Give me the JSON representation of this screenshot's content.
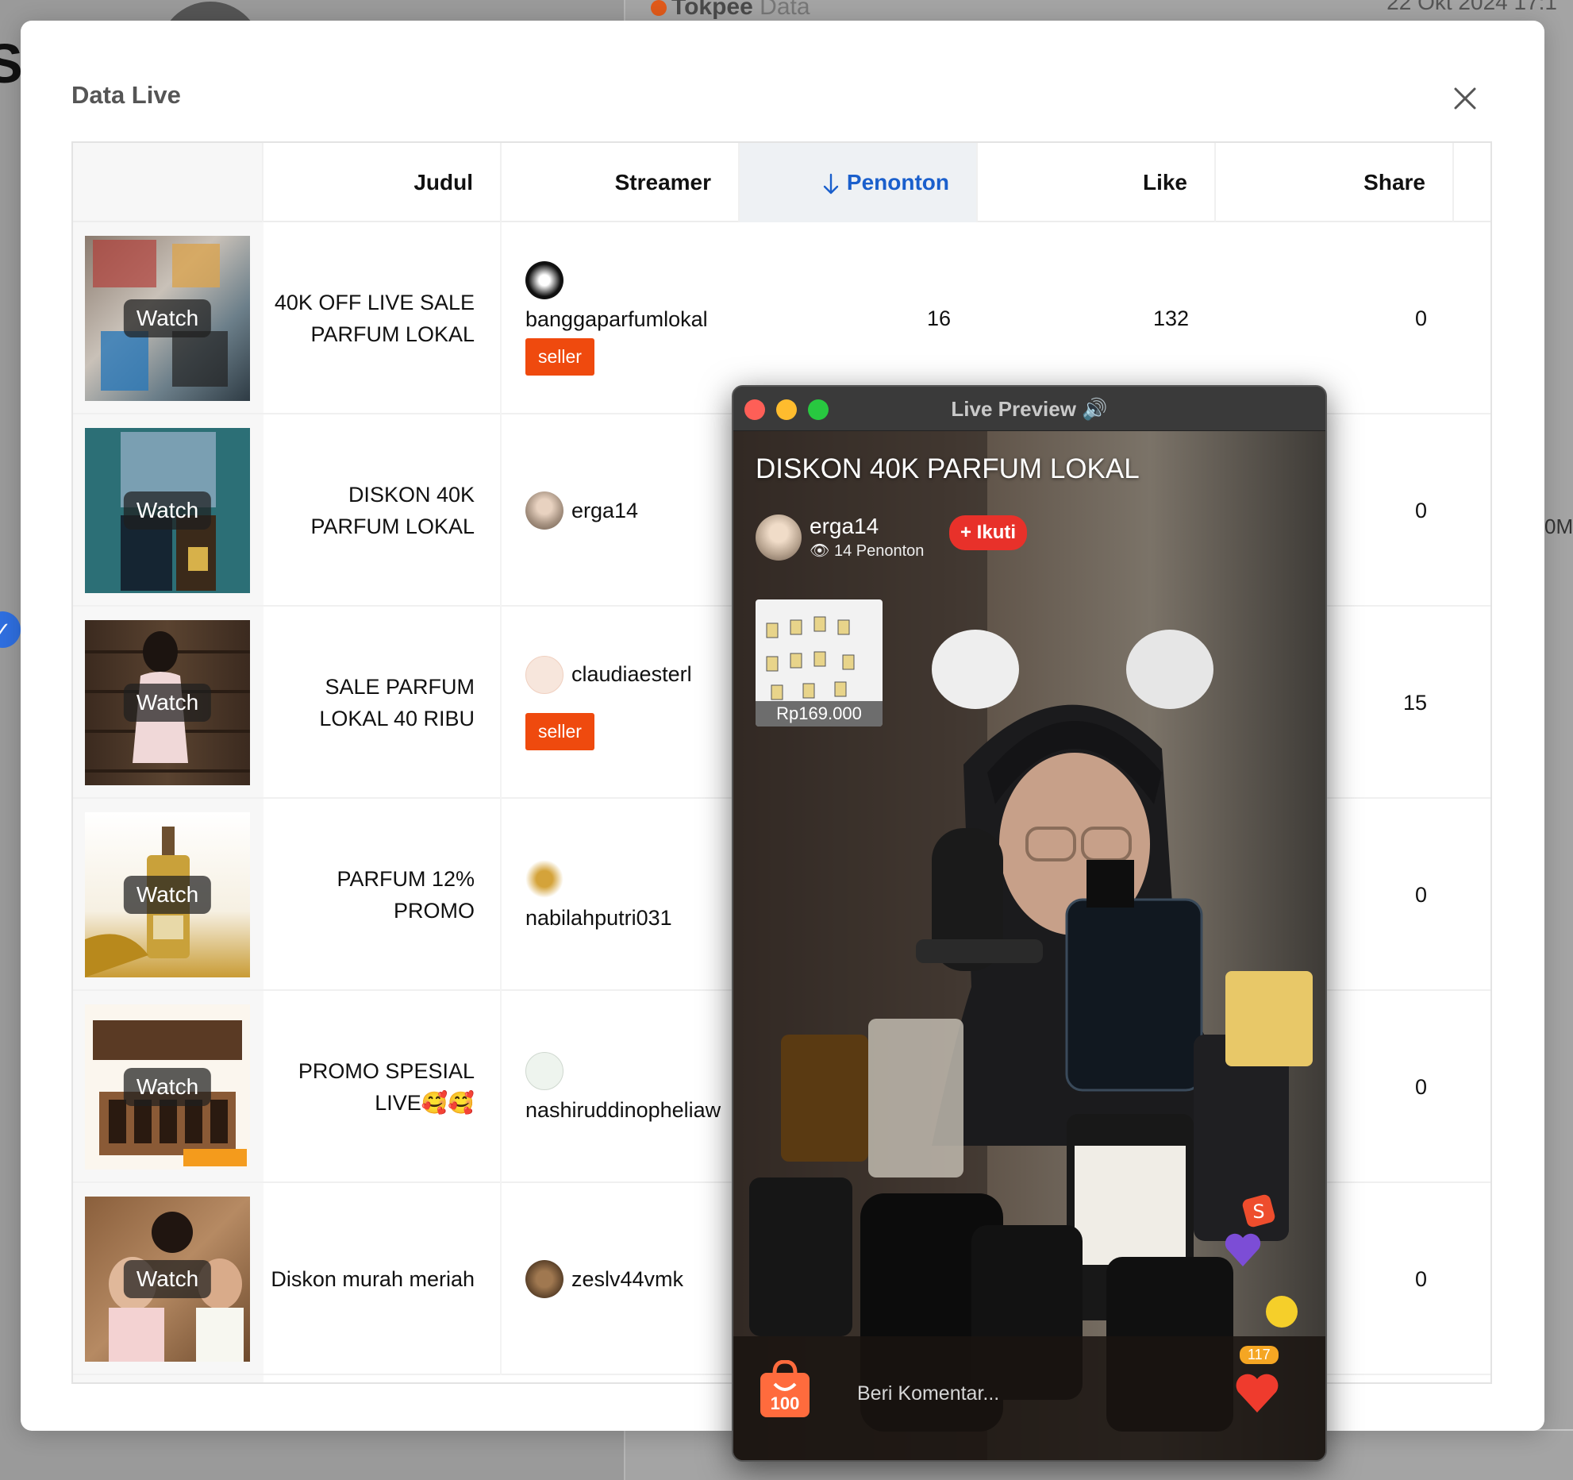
{
  "background": {
    "brand": "Tokpee",
    "brand_suffix": "Data",
    "date": "22 Okt 2024 17:1",
    "partial_letter": "S",
    "partial_value": "0M"
  },
  "modal": {
    "title": "Data Live",
    "close_icon": "close-icon"
  },
  "table": {
    "columns": [
      "Judul",
      "Streamer",
      "Penonton",
      "Like",
      "Share"
    ],
    "sorted_column": "Penonton",
    "sort_direction": "descending",
    "watch_label": "Watch",
    "seller_label": "seller",
    "rows": [
      {
        "title": "40K OFF LIVE SALE PARFUM LOKAL",
        "streamer": "banggaparfumlokal",
        "seller": true,
        "penonton": "16",
        "like": "132",
        "share": "0"
      },
      {
        "title": "DISKON 40K PARFUM LOKAL",
        "streamer": "erga14",
        "seller": false,
        "penonton": "",
        "like": "",
        "share": "0"
      },
      {
        "title": "SALE PARFUM LOKAL 40 RIBU",
        "streamer": "claudiaesterl",
        "seller": true,
        "penonton": "",
        "like": "",
        "share": "15"
      },
      {
        "title": "PARFUM 12% PROMO",
        "streamer": "nabilahputri031",
        "seller": false,
        "penonton": "",
        "like": "",
        "share": "0"
      },
      {
        "title": "PROMO SPESIAL LIVE🥰🥰",
        "streamer": "nashiruddinopheliaw",
        "seller": false,
        "penonton": "",
        "like": "",
        "share": "0"
      },
      {
        "title": "Diskon murah meriah",
        "streamer": "zeslv44vmk",
        "seller": false,
        "penonton": "",
        "like": "",
        "share": "0"
      }
    ]
  },
  "preview": {
    "window_title": "Live Preview 🔊",
    "live_title": "DISKON 40K PARFUM LOKAL",
    "host_name": "erga14",
    "viewers": "14 Penonton",
    "follow_label": "+ Ikuti",
    "product_price": "Rp169.000",
    "bag_count": "100",
    "comment_placeholder": "Beri Komentar...",
    "like_count": "117"
  },
  "colors": {
    "accent_blue": "#1a5fcc",
    "seller_orange": "#ef4a0e",
    "follow_red": "#e8312a"
  }
}
